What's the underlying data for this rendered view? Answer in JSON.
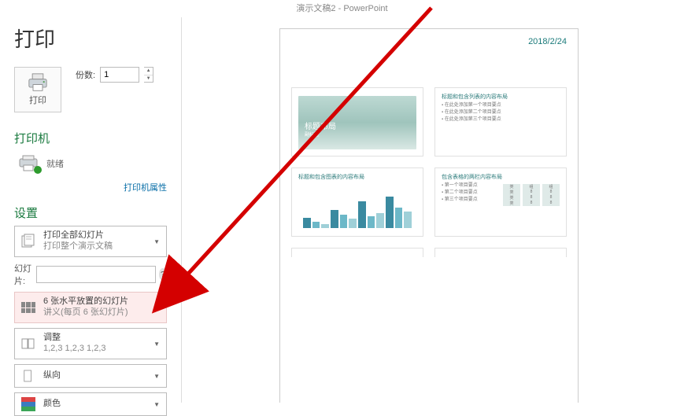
{
  "titlebar": "演示文稿2 - PowerPoint",
  "page_title": "打印",
  "print_button": {
    "label": "打印"
  },
  "copies": {
    "label": "份数:",
    "value": "1"
  },
  "sections": {
    "printer": "打印机",
    "settings": "设置"
  },
  "printer": {
    "status": "就绪",
    "properties_link": "打印机属性"
  },
  "dd_scope": {
    "line1": "打印全部幻灯片",
    "line2": "打印整个演示文稿"
  },
  "slides_field": {
    "label": "幻灯片:",
    "value": ""
  },
  "dd_layout": {
    "line1": "6 张水平放置的幻灯片",
    "line2": "讲义(每页 6 张幻灯片)"
  },
  "dd_collate": {
    "line1": "调整",
    "line2": "1,2,3    1,2,3    1,2,3"
  },
  "dd_orient": {
    "line1": "纵向"
  },
  "dd_color": {
    "line1": "颜色"
  },
  "preview_date": "2018/2/24",
  "slide1": {
    "title": "标题布局",
    "subtitle": "副标题"
  },
  "slide2": {
    "heading": "标题和包含列表的内容布局",
    "bullets": [
      "在此处添加第一个项目要点",
      "在此处添加第二个项目要点",
      "在此处添加第三个项目要点"
    ]
  },
  "slide3": {
    "heading": "标题和包含图表的内容布局"
  },
  "slide4": {
    "heading": "包含表格的两栏内容布局",
    "bullets": [
      "第一个项目要点",
      "第二个项目要点",
      "第三个项目要点"
    ]
  }
}
